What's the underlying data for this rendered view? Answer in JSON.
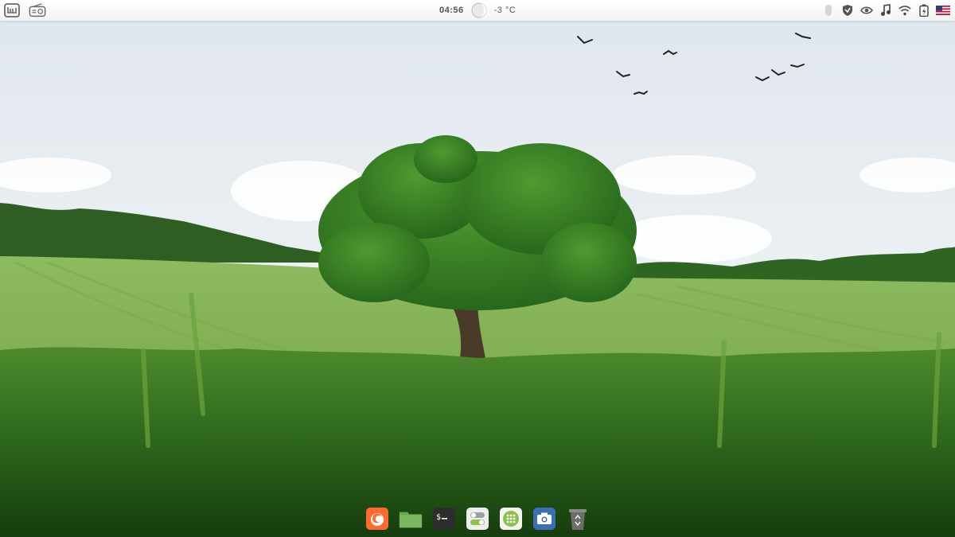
{
  "panel": {
    "clock": "04:56",
    "temperature": "-3 °C",
    "left_icons": [
      "mint-menu-icon",
      "radio-icon"
    ],
    "tray_icons": [
      "bluetooth-icon",
      "shield-icon",
      "nvidia-icon",
      "music-icon",
      "wifi-icon",
      "battery-icon",
      "us-flag-icon"
    ]
  },
  "dock": {
    "items": [
      "firefox-icon",
      "files-folder-icon",
      "terminal-icon",
      "settings-toggle-icon",
      "apps-grid-icon",
      "screenshot-camera-icon",
      "trash-icon"
    ]
  },
  "colors": {
    "panel_bg": "#f4f5f6",
    "panel_text": "#555555",
    "firefox": "#ff6b2c",
    "folder": "#7bb661",
    "terminal": "#2d2d2d",
    "apps_grid": "#8bc34a",
    "camera": "#3d6fb7",
    "trash": "#6d6d6d"
  }
}
